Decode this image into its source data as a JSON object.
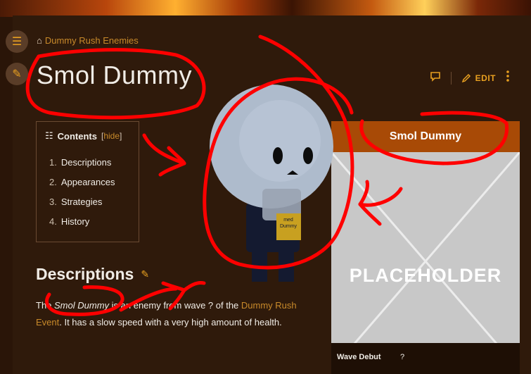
{
  "breadcrumb": {
    "separator": "⌂",
    "link": "Dummy Rush Enemies"
  },
  "page": {
    "title": "Smol Dummy"
  },
  "actions": {
    "edit_label": "EDIT"
  },
  "toc": {
    "heading": "Contents",
    "hide_open": "[",
    "hide_label": "hide",
    "hide_close": "]",
    "items": [
      {
        "num": "1.",
        "label": "Descriptions"
      },
      {
        "num": "2.",
        "label": "Appearances"
      },
      {
        "num": "3.",
        "label": "Strategies"
      },
      {
        "num": "4.",
        "label": "History"
      }
    ]
  },
  "section": {
    "heading": "Descriptions"
  },
  "description": {
    "t1": "The ",
    "name": "Smol Dummy",
    "t2": " is an enemy from wave ? of the ",
    "link": "Dummy Rush Event",
    "t3": ". It has a slow speed with a very high amount of health."
  },
  "infobox": {
    "title": "Smol Dummy",
    "image_text": "PLACEHOLDER",
    "row_label": "Wave Debut",
    "row_value": "?"
  },
  "character": {
    "badge_line1": "med",
    "badge_line2": "Dummy"
  },
  "colors": {
    "accent": "#e8a020",
    "infobox_header": "#a84a06",
    "scribble": "#ff0000",
    "background": "#2f1a0b"
  },
  "icons": [
    "list-icon",
    "pencil-icon",
    "speech-bubble-icon",
    "edit-pencil-icon",
    "more-vertical-icon",
    "home-icon"
  ]
}
